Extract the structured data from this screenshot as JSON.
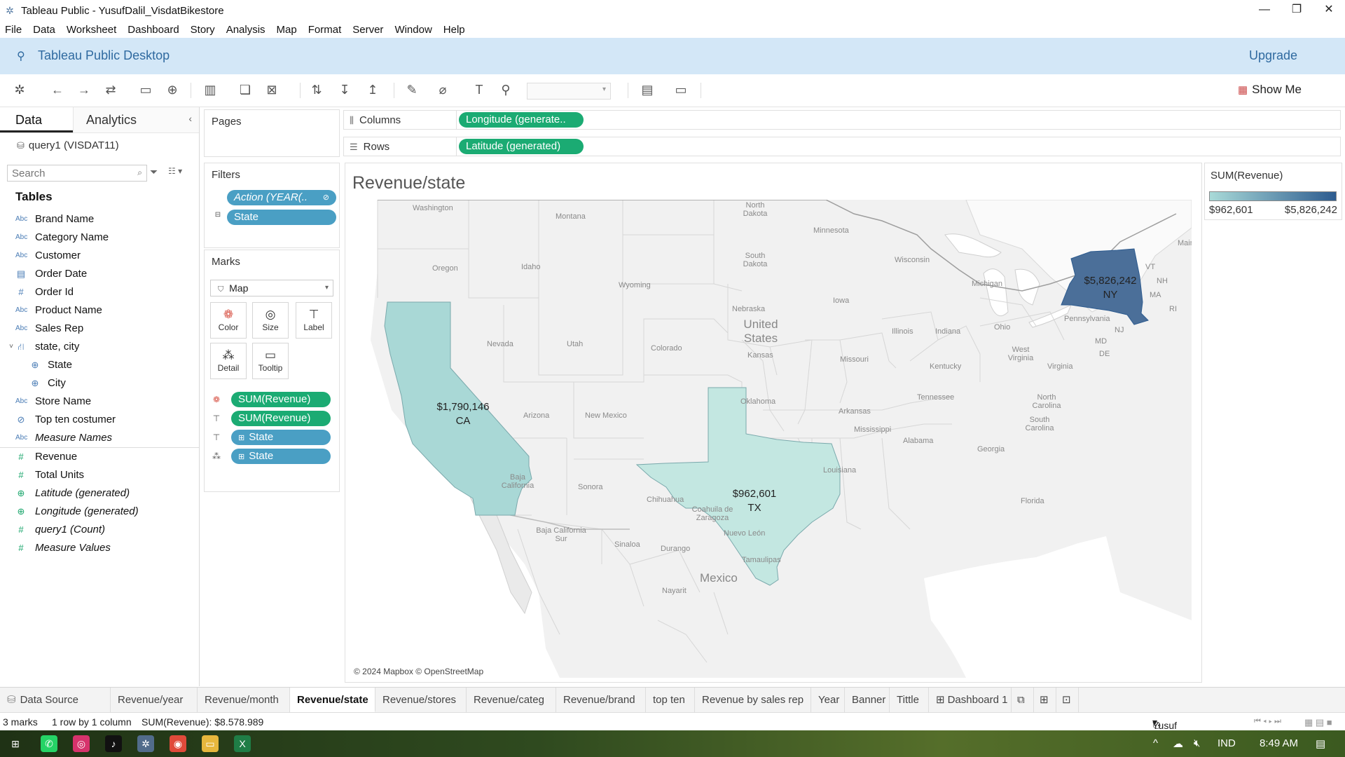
{
  "window": {
    "title": "Tableau Public - YusufDalil_VisdatBikestore"
  },
  "menu": [
    "File",
    "Data",
    "Worksheet",
    "Dashboard",
    "Story",
    "Analysis",
    "Map",
    "Format",
    "Server",
    "Window",
    "Help"
  ],
  "banner": {
    "product": "Tableau Public Desktop",
    "upgrade": "Upgrade"
  },
  "toolbar": {
    "show_me": "Show Me"
  },
  "data_pane": {
    "tab_data": "Data",
    "tab_analytics": "Analytics",
    "datasource": "query1 (VISDAT11)",
    "search_placeholder": "Search",
    "tables_heading": "Tables",
    "fields": [
      {
        "icon": "Abc",
        "label": "Brand Name"
      },
      {
        "icon": "Abc",
        "label": "Category Name"
      },
      {
        "icon": "Abc",
        "label": "Customer"
      },
      {
        "icon": "calendar",
        "label": "Order Date"
      },
      {
        "icon": "#",
        "label": "Order Id"
      },
      {
        "icon": "Abc",
        "label": "Product Name"
      },
      {
        "icon": "Abc",
        "label": "Sales Rep"
      },
      {
        "icon": "hierarchy",
        "label": "state, city"
      },
      {
        "icon": "globe",
        "label": "State"
      },
      {
        "icon": "globe",
        "label": "City"
      },
      {
        "icon": "Abc",
        "label": "Store Name"
      },
      {
        "icon": "set",
        "label": "Top ten costumer"
      },
      {
        "icon": "Abc",
        "label": "Measure Names"
      },
      {
        "icon": "#",
        "label": "Revenue"
      },
      {
        "icon": "#",
        "label": "Total Units"
      },
      {
        "icon": "globe",
        "label": "Latitude (generated)"
      },
      {
        "icon": "globe",
        "label": "Longitude (generated)"
      },
      {
        "icon": "#",
        "label": "query1 (Count)"
      },
      {
        "icon": "#",
        "label": "Measure Values"
      }
    ]
  },
  "cards": {
    "pages": "Pages",
    "filters": "Filters",
    "filter_pills": [
      "Action (YEAR(..",
      "State"
    ],
    "marks": "Marks",
    "mark_type": "Map",
    "mark_buttons": [
      "Color",
      "Size",
      "Label",
      "Detail",
      "Tooltip"
    ],
    "mark_pills": [
      "SUM(Revenue)",
      "SUM(Revenue)",
      "State",
      "State"
    ]
  },
  "shelves": {
    "columns_label": "Columns",
    "columns_pill": "Longitude (generate..",
    "rows_label": "Rows",
    "rows_pill": "Latitude (generated)"
  },
  "view": {
    "title": "Revenue/state",
    "copyright": "© 2024 Mapbox © OpenStreetMap",
    "labels": {
      "ca_value": "$1,790,146",
      "ca_state": "CA",
      "tx_value": "$962,601",
      "tx_state": "TX",
      "ny_value": "$5,826,242",
      "ny_state": "NY"
    },
    "map_labels": [
      "Washington",
      "Montana",
      "North Dakota",
      "Minnesota",
      "Oregon",
      "Idaho",
      "South Dakota",
      "Wisconsin",
      "Wyoming",
      "Michigan",
      "Nebraska",
      "Iowa",
      "United States",
      "Nevada",
      "Utah",
      "Colorado",
      "Illinois",
      "Indiana",
      "Ohio",
      "Pennsylvania",
      "Kansas",
      "Missouri",
      "West Virginia",
      "Virginia",
      "Kentucky",
      "Oklahoma",
      "Arizona",
      "New Mexico",
      "Tennessee",
      "North Carolina",
      "Arkansas",
      "South Carolina",
      "Mississippi",
      "Alabama",
      "Georgia",
      "Louisiana",
      "Florida",
      "Baja California",
      "Sonora",
      "Chihuahua",
      "Coahuila de Zaragoza",
      "Baja California Sur",
      "Sinaloa",
      "Durango",
      "Nuevo León",
      "Tamaulipas",
      "Mexico",
      "Nayarit",
      "VT",
      "NH",
      "MA",
      "RI",
      "NJ",
      "MD",
      "DE",
      "Maine"
    ]
  },
  "legend": {
    "title": "SUM(Revenue)",
    "min": "$962,601",
    "max": "$5,826,242",
    "color_low": "#a9dad8",
    "color_high": "#2d5b8f"
  },
  "chart_data": {
    "type": "heatmap",
    "title": "Revenue/state",
    "categories": [
      "CA",
      "TX",
      "NY"
    ],
    "values": [
      1790146,
      962601,
      5826242
    ],
    "legend": "top-right"
  },
  "sheet_tabs": [
    "Data Source",
    "Revenue/year",
    "Revenue/month",
    "Revenue/state",
    "Revenue/stores",
    "Revenue/categ",
    "Revenue/brand",
    "top ten",
    "Revenue by sales rep",
    "Year",
    "Banner",
    "Tittle",
    "Dashboard 1"
  ],
  "status": {
    "marks": "3 marks",
    "rows": "1 row by 1 column",
    "sum": "SUM(Revenue): $8.578.989",
    "user": "Yusuf Dalil Falihin"
  },
  "taskbar": {
    "lang": "IND",
    "time": "8:49 AM"
  }
}
